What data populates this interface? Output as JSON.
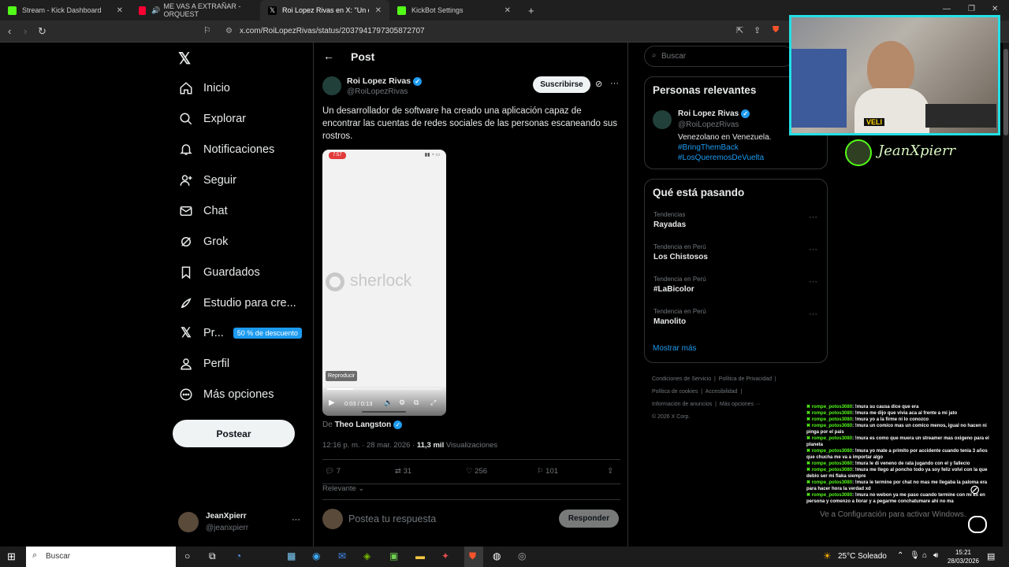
{
  "browser": {
    "tabs": [
      {
        "title": "Stream - Kick Dashboard",
        "color": "#53fc18",
        "active": false
      },
      {
        "title": "ME VAS A EXTRAÑAR - ORQUEST",
        "color": "#ff0033",
        "active": false
      },
      {
        "title": "Roi Lopez Rivas en X: \"Un desarr",
        "color": "#000000",
        "active": true
      },
      {
        "title": "KickBot Settings",
        "color": "#53fc18",
        "active": false
      }
    ],
    "new_tab": "+",
    "url": "x.com/RoiLopezRivas/status/2037941797305872707"
  },
  "nav": {
    "items": [
      {
        "label": "Inicio",
        "icon": "home-icon"
      },
      {
        "label": "Explorar",
        "icon": "search-icon"
      },
      {
        "label": "Notificaciones",
        "icon": "bell-icon"
      },
      {
        "label": "Seguir",
        "icon": "follow-icon"
      },
      {
        "label": "Chat",
        "icon": "mail-icon"
      },
      {
        "label": "Grok",
        "icon": "grok-icon"
      },
      {
        "label": "Guardados",
        "icon": "bookmark-icon"
      },
      {
        "label": "Estudio para cre...",
        "icon": "rocket-icon"
      },
      {
        "label": "Pr...",
        "icon": "x-logo-icon"
      },
      {
        "label": "Perfil",
        "icon": "person-icon"
      },
      {
        "label": "Más opciones",
        "icon": "more-circle-icon"
      }
    ],
    "premium_badge": "50 % de descuento",
    "post_button": "Postear",
    "account": {
      "name": "JeanXpierr",
      "handle": "@jeanxpierr"
    }
  },
  "post": {
    "header_title": "Post",
    "author_name": "Roi Lopez Rivas",
    "author_handle": "@RoiLopezRivas",
    "subscribe": "Suscribirse",
    "text": "Un desarrollador de software ha creado una aplicación capaz de encontrar las cuentas de redes sociales de las personas escaneando sus rostros.",
    "video": {
      "time_badge": "7:57",
      "logo_text": "sherlock",
      "tooltip": "Reproducir",
      "time": "0:03 / 0:13",
      "progress": 0.23
    },
    "from_label": "De",
    "from_name": "Theo Langston",
    "timestamp": "12:16 p. m. · 28 mar. 2026 ·",
    "views_count": "11,3 mil",
    "views_label": "Visualizaciones",
    "replies": "7",
    "reposts": "31",
    "likes": "256",
    "bookmarks": "101",
    "relevant": "Relevante",
    "reply_placeholder": "Postea tu respuesta",
    "reply_button": "Responder"
  },
  "right": {
    "search_placeholder": "Buscar",
    "relevant_title": "Personas relevantes",
    "person": {
      "name": "Roi Lopez Rivas",
      "handle": "@RoiLopezRivas",
      "bio": "Venezolano en Venezuela.",
      "tag1": "#BringThemBack",
      "tag2": "#LosQueremosDeVuelta"
    },
    "trending_title": "Qué está pasando",
    "trends": [
      {
        "category": "Tendencias",
        "name": "Rayadas"
      },
      {
        "category": "Tendencia en Perú",
        "name": "Los Chistosos"
      },
      {
        "category": "Tendencia en Perú",
        "name": "#LaBicolor"
      },
      {
        "category": "Tendencia en Perú",
        "name": "Manolito"
      }
    ],
    "show_more": "Mostrar más",
    "footer": [
      "Condiciones de Servicio",
      "Política de Privacidad",
      "Política de cookies",
      "Accesibilidad",
      "Información de anuncios",
      "Más opciones ···",
      "© 2026 X Corp."
    ]
  },
  "stream": {
    "streamer_name": "JeanXpierr",
    "cam_label": "VELI",
    "chat": [
      {
        "user": "rompe_potos3080",
        "msg": ": !mura su causa dice que era"
      },
      {
        "user": "rompe_potos3080",
        "msg": ": !mura me dijo que vivia aca al frente a mi jato"
      },
      {
        "user": "rompe_potos3080",
        "msg": ": !mura yo a la firme ni lo conozco"
      },
      {
        "user": "rompe_potos3080",
        "msg": ": !mura un comico mas un comico menos, igual no hacen ni pinga por el pais"
      },
      {
        "user": "rompe_potos3080",
        "msg": ": !mura es como que muera un streamer mas oxigeno para el planeta"
      },
      {
        "user": "rompe_potos3080",
        "msg": ": !mura yo mate a primito por accidente cuando tenia 3 años que chucha me va a importar algo"
      },
      {
        "user": "rompe_potos3080",
        "msg": ": !mura le di veneno de rata jugando con el y fallecio"
      },
      {
        "user": "rompe_potos3080",
        "msg": ": !mura me llego al poncho todo ya soy feliz volvi con la que debio ser mi flaka siempre"
      },
      {
        "user": "rompe_potos3080",
        "msg": ": !mura le termine por chat no mas me llegaba la paloma era para hacer hora la verdad xd"
      },
      {
        "user": "rompe_potos3080",
        "msg": ": !mura no webon ya me paso cuando termine con mi ex en persona y comenzo a llorar y a pegarme conchatumare ahi no ma"
      }
    ],
    "watermark": "Ve a Configuración para activar Windows."
  },
  "taskbar": {
    "search": "Buscar",
    "weather": "25°C Soleado",
    "time": "15:21",
    "date": "28/03/2026"
  }
}
